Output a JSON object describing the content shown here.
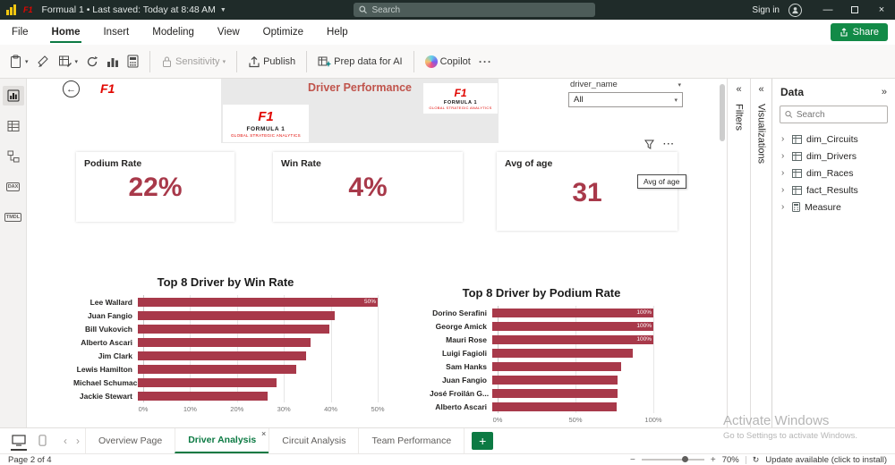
{
  "titlebar": {
    "title": "Formual 1 • Last saved: Today at 8:48 AM",
    "search_placeholder": "Search",
    "sign_in_label": "Sign in"
  },
  "menu": {
    "items": [
      "File",
      "Home",
      "Insert",
      "Modeling",
      "View",
      "Optimize",
      "Help"
    ],
    "active": "Home",
    "share_label": "Share"
  },
  "ribbon": {
    "sensitivity_label": "Sensitivity",
    "publish_label": "Publish",
    "prep_ai_label": "Prep data for AI",
    "copilot_label": "Copilot"
  },
  "report": {
    "header_title": "Driver Performance",
    "logo": {
      "f1": "F1",
      "line1": "FORMULA 1",
      "line2": "GLOBAL STRATEGIC ANALYTICS"
    },
    "slicer": {
      "field": "driver_name",
      "value": "All"
    },
    "cards": [
      {
        "label": "Podium Rate",
        "value": "22%"
      },
      {
        "label": "Win Rate",
        "value": "4%"
      },
      {
        "label": "Avg of age",
        "value": "31",
        "tooltip": "Avg of age"
      }
    ]
  },
  "chart_data": [
    {
      "type": "bar",
      "orientation": "horizontal",
      "title": "Top 8 Driver by Win Rate",
      "categories": [
        "Lee Wallard",
        "Juan Fangio",
        "Bill Vukovich",
        "Alberto Ascari",
        "Jim Clark",
        "Lewis Hamilton",
        "Michael Schumacher",
        "Jackie Stewart"
      ],
      "values": [
        50,
        41,
        40,
        36,
        35,
        33,
        29,
        27
      ],
      "data_labels": [
        "50%",
        "",
        "",
        "",
        "",
        "",
        "",
        ""
      ],
      "xlim": [
        0,
        50
      ],
      "x_ticks": [
        "0%",
        "10%",
        "20%",
        "30%",
        "40%",
        "50%"
      ],
      "bar_color": "#a8394a",
      "grid": true,
      "legend": false
    },
    {
      "type": "bar",
      "orientation": "horizontal",
      "title": "Top 8 Driver by Podium Rate",
      "categories": [
        "Dorino Serafini",
        "George Amick",
        "Mauri Rose",
        "Luigi Fagioli",
        "Sam Hanks",
        "Juan Fangio",
        "José Froilán G...",
        "Alberto Ascari"
      ],
      "values": [
        100,
        100,
        100,
        87,
        80,
        78,
        78,
        77
      ],
      "data_labels": [
        "100%",
        "100%",
        "100%",
        "",
        "",
        "",
        "",
        ""
      ],
      "xlim": [
        0,
        100
      ],
      "x_ticks": [
        "0%",
        "50%",
        "100%"
      ],
      "bar_color": "#a8394a",
      "grid": true,
      "legend": false
    }
  ],
  "panels": {
    "filters_label": "Filters",
    "visualizations_label": "Visualizations",
    "data": {
      "title": "Data",
      "search_placeholder": "Search",
      "items": [
        {
          "label": "dim_Circuits",
          "icon": "table"
        },
        {
          "label": "dim_Drivers",
          "icon": "table"
        },
        {
          "label": "dim_Races",
          "icon": "table"
        },
        {
          "label": "fact_Results",
          "icon": "table"
        },
        {
          "label": "Measure",
          "icon": "calculator"
        }
      ]
    }
  },
  "pages": {
    "tabs": [
      "Overview Page",
      "Driver Analysis",
      "Circuit Analysis",
      "Team Performance"
    ],
    "active": "Driver Analysis"
  },
  "statusbar": {
    "page_info": "Page 2 of 4",
    "zoom": "70%",
    "update_text": "Update available (click to install)"
  },
  "watermark": {
    "line1": "Activate Windows",
    "line2": "Go to Settings to activate Windows."
  },
  "colors": {
    "accent_green": "#0c7a43",
    "maroon": "#a8394a",
    "titlebar": "#1f2b29",
    "f1_red": "#e10600"
  }
}
